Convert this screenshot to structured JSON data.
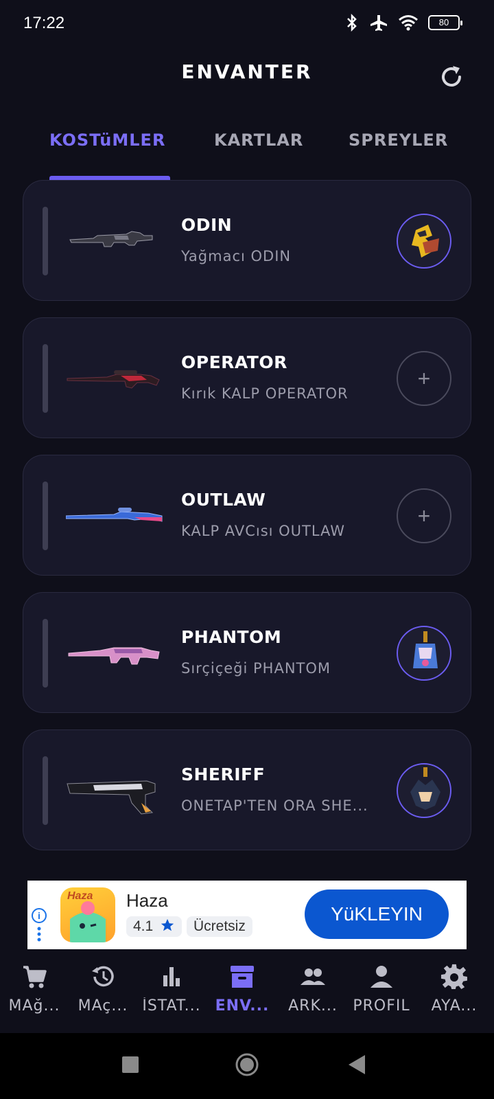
{
  "status_bar": {
    "time": "17:22",
    "battery": "80"
  },
  "header": {
    "title": "ENVANTER"
  },
  "tabs": [
    {
      "label": "KOSTüMLER",
      "active": true
    },
    {
      "label": "KARTLAR",
      "active": false
    },
    {
      "label": "SPREYLER",
      "active": false
    }
  ],
  "items": [
    {
      "weapon": "ODIN",
      "skin": "Yağmacı ODIN",
      "buddy": "equipped"
    },
    {
      "weapon": "OPERATOR",
      "skin": "Kırık KALP OPERATOR",
      "buddy": "empty"
    },
    {
      "weapon": "OUTLAW",
      "skin": "KALP AVCısı OUTLAW",
      "buddy": "empty"
    },
    {
      "weapon": "PHANTOM",
      "skin": "Sırçiçeği PHANTOM",
      "buddy": "equipped"
    },
    {
      "weapon": "SHERIFF",
      "skin": "ONETAP'TEN ORA SHE...",
      "buddy": "equipped"
    }
  ],
  "ad": {
    "app_name": "Haza",
    "rating": "4.1",
    "price": "Ücretsiz",
    "install_label": "YüKLEYIN",
    "icon_text": "Haza",
    "colors": {
      "button": "#0b57d0"
    }
  },
  "nav": [
    {
      "label": "MAğ...",
      "icon": "cart-icon"
    },
    {
      "label": "MAç...",
      "icon": "history-icon"
    },
    {
      "label": "İSTAT...",
      "icon": "stats-icon"
    },
    {
      "label": "ENV...",
      "icon": "inventory-icon",
      "active": true
    },
    {
      "label": "ARK...",
      "icon": "friends-icon"
    },
    {
      "label": "PROFIL",
      "icon": "profile-icon"
    },
    {
      "label": "AYA...",
      "icon": "settings-icon"
    }
  ],
  "colors": {
    "accent": "#6b5cf0",
    "background": "#0f0f1a",
    "card": "#18182a"
  }
}
